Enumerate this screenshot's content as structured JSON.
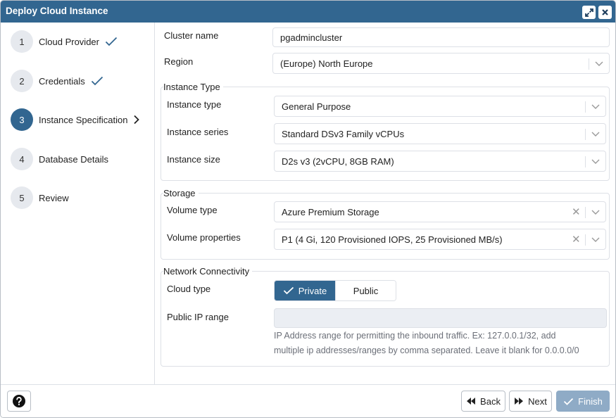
{
  "window": {
    "title": "Deploy Cloud Instance"
  },
  "steps": [
    {
      "num": "1",
      "label": "Cloud Provider",
      "state": "done"
    },
    {
      "num": "2",
      "label": "Credentials",
      "state": "done"
    },
    {
      "num": "3",
      "label": "Instance Specification",
      "state": "active"
    },
    {
      "num": "4",
      "label": "Database Details",
      "state": "pending"
    },
    {
      "num": "5",
      "label": "Review",
      "state": "pending"
    }
  ],
  "form": {
    "cluster_name": {
      "label": "Cluster name",
      "value": "pgadmincluster"
    },
    "region": {
      "label": "Region",
      "value": "(Europe) North Europe"
    },
    "instance_type_section": {
      "legend": "Instance Type",
      "instance_type": {
        "label": "Instance type",
        "value": "General Purpose"
      },
      "instance_series": {
        "label": "Instance series",
        "value": "Standard DSv3 Family vCPUs"
      },
      "instance_size": {
        "label": "Instance size",
        "value": "D2s v3 (2vCPU, 8GB RAM)"
      }
    },
    "storage_section": {
      "legend": "Storage",
      "volume_type": {
        "label": "Volume type",
        "value": "Azure Premium Storage"
      },
      "volume_properties": {
        "label": "Volume properties",
        "value": "P1 (4 Gi, 120 Provisioned IOPS, 25 Provisioned MB/s)"
      }
    },
    "network_section": {
      "legend": "Network Connectivity",
      "cloud_type": {
        "label": "Cloud type",
        "options": [
          "Private",
          "Public"
        ],
        "selected": "Private"
      },
      "public_ip_range": {
        "label": "Public IP range",
        "value": "",
        "help_line1": "IP Address range for permitting the inbound traffic. Ex: 127.0.0.1/32, add",
        "help_line2": "multiple ip addresses/ranges by comma separated. Leave it blank for 0.0.0.0/0"
      }
    }
  },
  "footer": {
    "help_icon": "question-circle-icon",
    "back_label": "Back",
    "next_label": "Next",
    "finish_label": "Finish"
  },
  "colors": {
    "accent": "#326690",
    "finish_disabled": "#8fabc6",
    "border": "#dde0e6"
  }
}
